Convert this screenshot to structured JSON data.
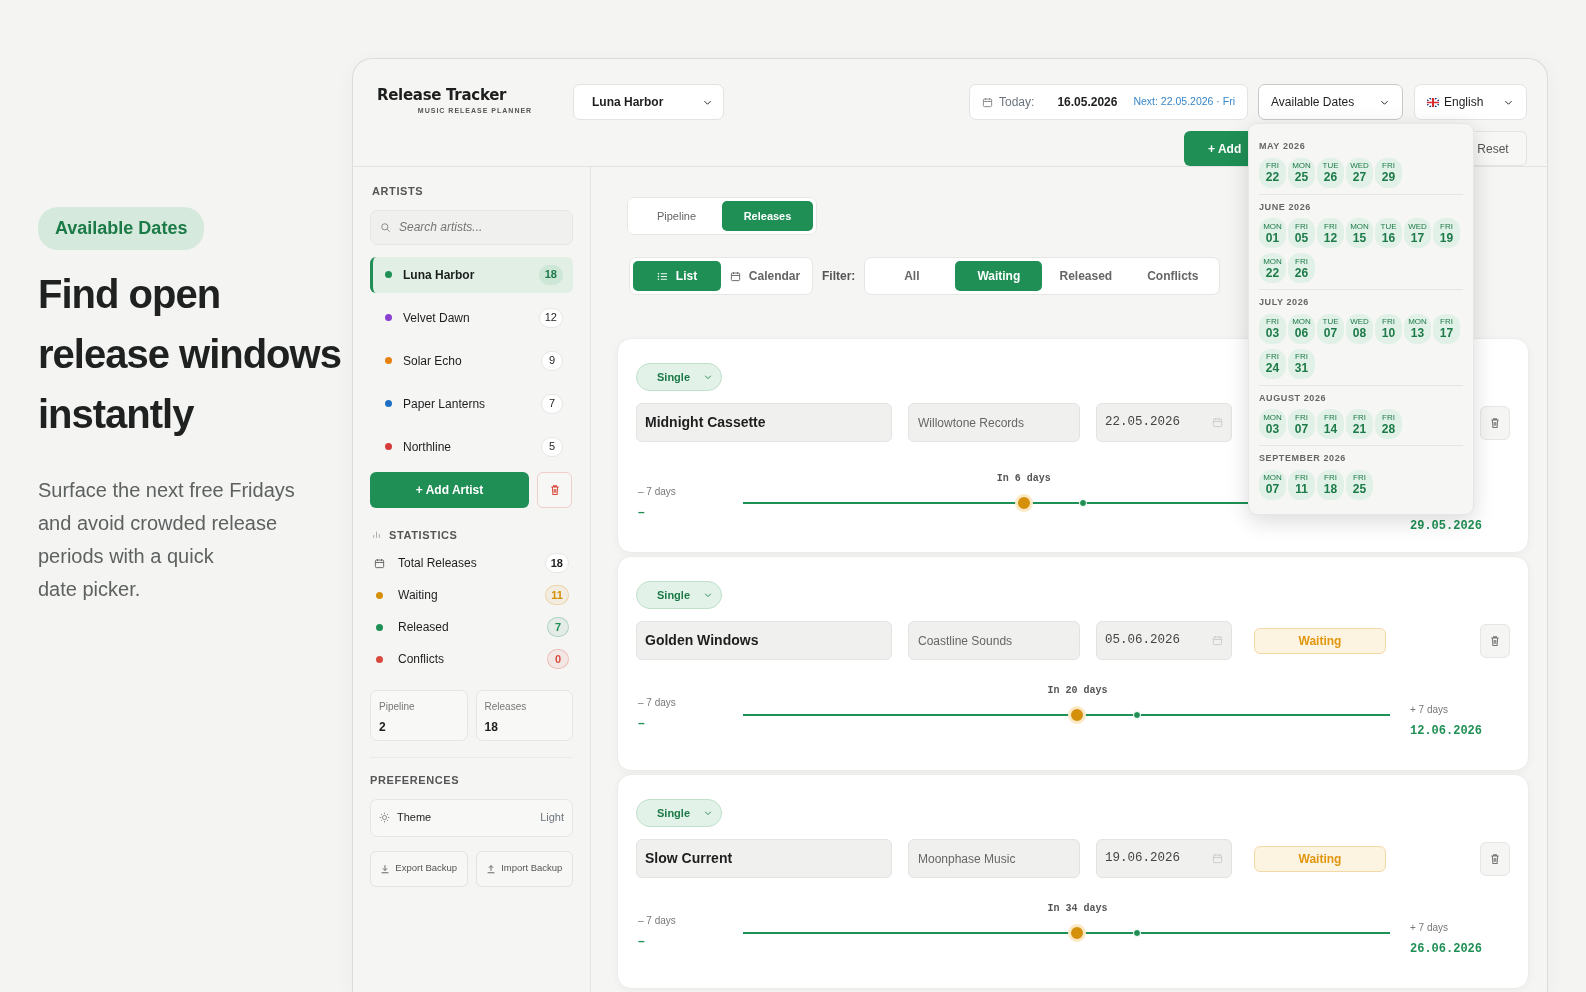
{
  "hero": {
    "badge": "Available Dates",
    "title": "Find open release windows instantly",
    "paragraph_lines": [
      "Surface the next free Fridays",
      "and avoid crowded release",
      "periods with a quick",
      "date picker."
    ]
  },
  "header": {
    "logo_title": "Release Tracker",
    "logo_subtitle": "MUSIC RELEASE PLANNER",
    "artist_select": "Luna Harbor",
    "today_label": "Today:",
    "today_date": "16.05.2026",
    "next": "Next: 22.05.2026 · Fri",
    "dates_select": {
      "value": "Available Dates",
      "expanded": true
    },
    "language_select": "English",
    "add_button": "+ Add",
    "reset_button": "Reset"
  },
  "available_dates_menu": {
    "months": [
      {
        "title": "MAY 2026",
        "dates": [
          {
            "weekday": "FRI",
            "day": "22"
          },
          {
            "weekday": "MON",
            "day": "25"
          },
          {
            "weekday": "TUE",
            "day": "26"
          },
          {
            "weekday": "WED",
            "day": "27"
          },
          {
            "weekday": "FRI",
            "day": "29"
          }
        ]
      },
      {
        "title": "JUNE 2026",
        "dates": [
          {
            "weekday": "MON",
            "day": "01"
          },
          {
            "weekday": "FRI",
            "day": "05"
          },
          {
            "weekday": "FRI",
            "day": "12"
          },
          {
            "weekday": "MON",
            "day": "15"
          },
          {
            "weekday": "TUE",
            "day": "16"
          },
          {
            "weekday": "WED",
            "day": "17"
          },
          {
            "weekday": "FRI",
            "day": "19"
          },
          {
            "weekday": "MON",
            "day": "22"
          },
          {
            "weekday": "FRI",
            "day": "26"
          }
        ]
      },
      {
        "title": "JULY 2026",
        "dates": [
          {
            "weekday": "FRI",
            "day": "03"
          },
          {
            "weekday": "MON",
            "day": "06"
          },
          {
            "weekday": "TUE",
            "day": "07"
          },
          {
            "weekday": "WED",
            "day": "08"
          },
          {
            "weekday": "FRI",
            "day": "10"
          },
          {
            "weekday": "MON",
            "day": "13"
          },
          {
            "weekday": "FRI",
            "day": "17"
          },
          {
            "weekday": "FRI",
            "day": "24"
          },
          {
            "weekday": "FRI",
            "day": "31"
          }
        ]
      },
      {
        "title": "AUGUST 2026",
        "dates": [
          {
            "weekday": "MON",
            "day": "03"
          },
          {
            "weekday": "FRI",
            "day": "07"
          },
          {
            "weekday": "FRI",
            "day": "14"
          },
          {
            "weekday": "FRI",
            "day": "21"
          },
          {
            "weekday": "FRI",
            "day": "28"
          }
        ]
      },
      {
        "title": "SEPTEMBER 2026",
        "dates": [
          {
            "weekday": "MON",
            "day": "07"
          },
          {
            "weekday": "FRI",
            "day": "11"
          },
          {
            "weekday": "FRI",
            "day": "18"
          },
          {
            "weekday": "FRI",
            "day": "25"
          }
        ]
      }
    ]
  },
  "sidebar": {
    "artists_heading": "ARTISTS",
    "search": {
      "placeholder": "Search artists..."
    },
    "artists": [
      {
        "name": "Luna Harbor",
        "color": "#1f8f55",
        "count": "18",
        "selected": true
      },
      {
        "name": "Velvet Dawn",
        "color": "#8a3fd1",
        "count": "12",
        "selected": false
      },
      {
        "name": "Solar Echo",
        "color": "#e8800f",
        "count": "9",
        "selected": false
      },
      {
        "name": "Paper Lanterns",
        "color": "#1e6fc4",
        "count": "7",
        "selected": false
      },
      {
        "name": "Northline",
        "color": "#d63a3a",
        "count": "5",
        "selected": false
      }
    ],
    "add_artist_button": "+ Add Artist",
    "statistics_heading": "STATISTICS",
    "statistics": [
      {
        "kind": "total",
        "label": "Total Releases",
        "count": "18"
      },
      {
        "kind": "dot",
        "label": "Waiting",
        "count": "11",
        "color": "#d4900b"
      },
      {
        "kind": "dot",
        "label": "Released",
        "count": "7",
        "color": "#1f8f55"
      },
      {
        "kind": "dot",
        "label": "Conflicts",
        "count": "0",
        "color": "#d94a3e"
      }
    ],
    "tiles": [
      {
        "label": "Pipeline",
        "value": "2"
      },
      {
        "label": "Releases",
        "value": "18"
      }
    ],
    "preferences_heading": "PREFERENCES",
    "theme": {
      "label": "Theme",
      "value": "Light"
    },
    "backup_buttons": [
      {
        "kind": "export",
        "label": "Export Backup"
      },
      {
        "kind": "import",
        "label": "Import Backup"
      }
    ]
  },
  "main": {
    "mode_tabs": [
      {
        "label": "Pipeline",
        "selected": false
      },
      {
        "label": "Releases",
        "selected": true
      }
    ],
    "view_tabs": [
      {
        "kind": "list",
        "label": "List",
        "selected": true
      },
      {
        "kind": "calendar",
        "label": "Calendar",
        "selected": false
      }
    ],
    "filter_label": "Filter:",
    "filters": [
      {
        "label": "All",
        "selected": false
      },
      {
        "label": "Waiting",
        "selected": true
      },
      {
        "label": "Released",
        "selected": false
      },
      {
        "label": "Conflicts",
        "selected": false
      }
    ],
    "releases": [
      {
        "type": "Single",
        "title": "Midnight Cassette",
        "label": "Willowtone Records",
        "date": "22.05.2026",
        "start_label": "– 7 days",
        "start_date": "–",
        "level": 0.434,
        "progress_label": "In 6 days",
        "end_date": "29.05.2026"
      },
      {
        "type": "Single",
        "title": "Golden Windows",
        "label": "Coastline Sounds",
        "date": "05.06.2026",
        "status": {
          "kind": "waiting",
          "label": "Waiting"
        },
        "start_label": "– 7 days",
        "start_date": "–",
        "level": 0.517,
        "progress_label": "In 20 days",
        "end_label": "+ 7 days",
        "end_date": "12.06.2026"
      },
      {
        "type": "Single",
        "title": "Slow Current",
        "label": "Moonphase Music",
        "date": "19.06.2026",
        "status": {
          "kind": "waiting",
          "label": "Waiting"
        },
        "start_label": "– 7 days",
        "start_date": "–",
        "level": 0.517,
        "progress_label": "In 34 days",
        "end_label": "+ 7 days",
        "end_date": "26.06.2026"
      }
    ]
  }
}
